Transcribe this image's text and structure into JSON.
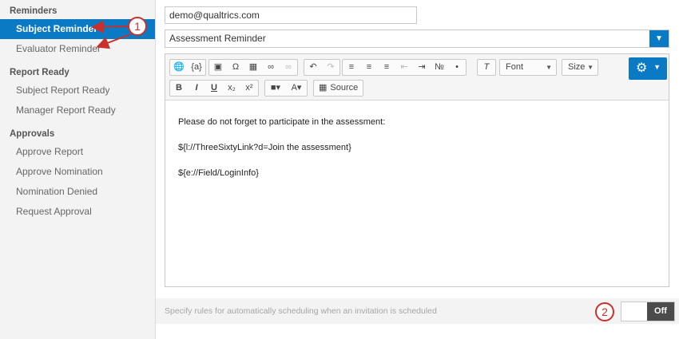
{
  "sidebar": {
    "sections": [
      {
        "title": "Reminders",
        "items": [
          "Subject Reminder",
          "Evaluator Reminder"
        ]
      },
      {
        "title": "Report Ready",
        "items": [
          "Subject Report Ready",
          "Manager Report Ready"
        ]
      },
      {
        "title": "Approvals",
        "items": [
          "Approve Report",
          "Approve Nomination",
          "Nomination Denied",
          "Request Approval"
        ]
      }
    ],
    "active_item": "Subject Reminder"
  },
  "form": {
    "from_email": "demo@qualtrics.com",
    "message_select": "Assessment Reminder"
  },
  "toolbar": {
    "font_label": "Font",
    "size_label": "Size",
    "source_label": "Source",
    "piped_text_label": "{a}",
    "bold": "B",
    "italic": "I",
    "underline": "U"
  },
  "editor": {
    "lines": [
      "Please do not forget to participate in the assessment:",
      "${l://ThreeSixtyLink?d=Join the assessment}",
      "${e://Field/LoginInfo}"
    ]
  },
  "footer": {
    "schedule_text": "Specify rules for automatically scheduling when an invitation is scheduled",
    "toggle_label": "Off"
  },
  "annotations": {
    "marker1": "1",
    "marker2": "2"
  },
  "colors": {
    "accent": "#0a7ac4",
    "annotation": "#c9302c",
    "toggle_off": "#4b4b4b"
  }
}
